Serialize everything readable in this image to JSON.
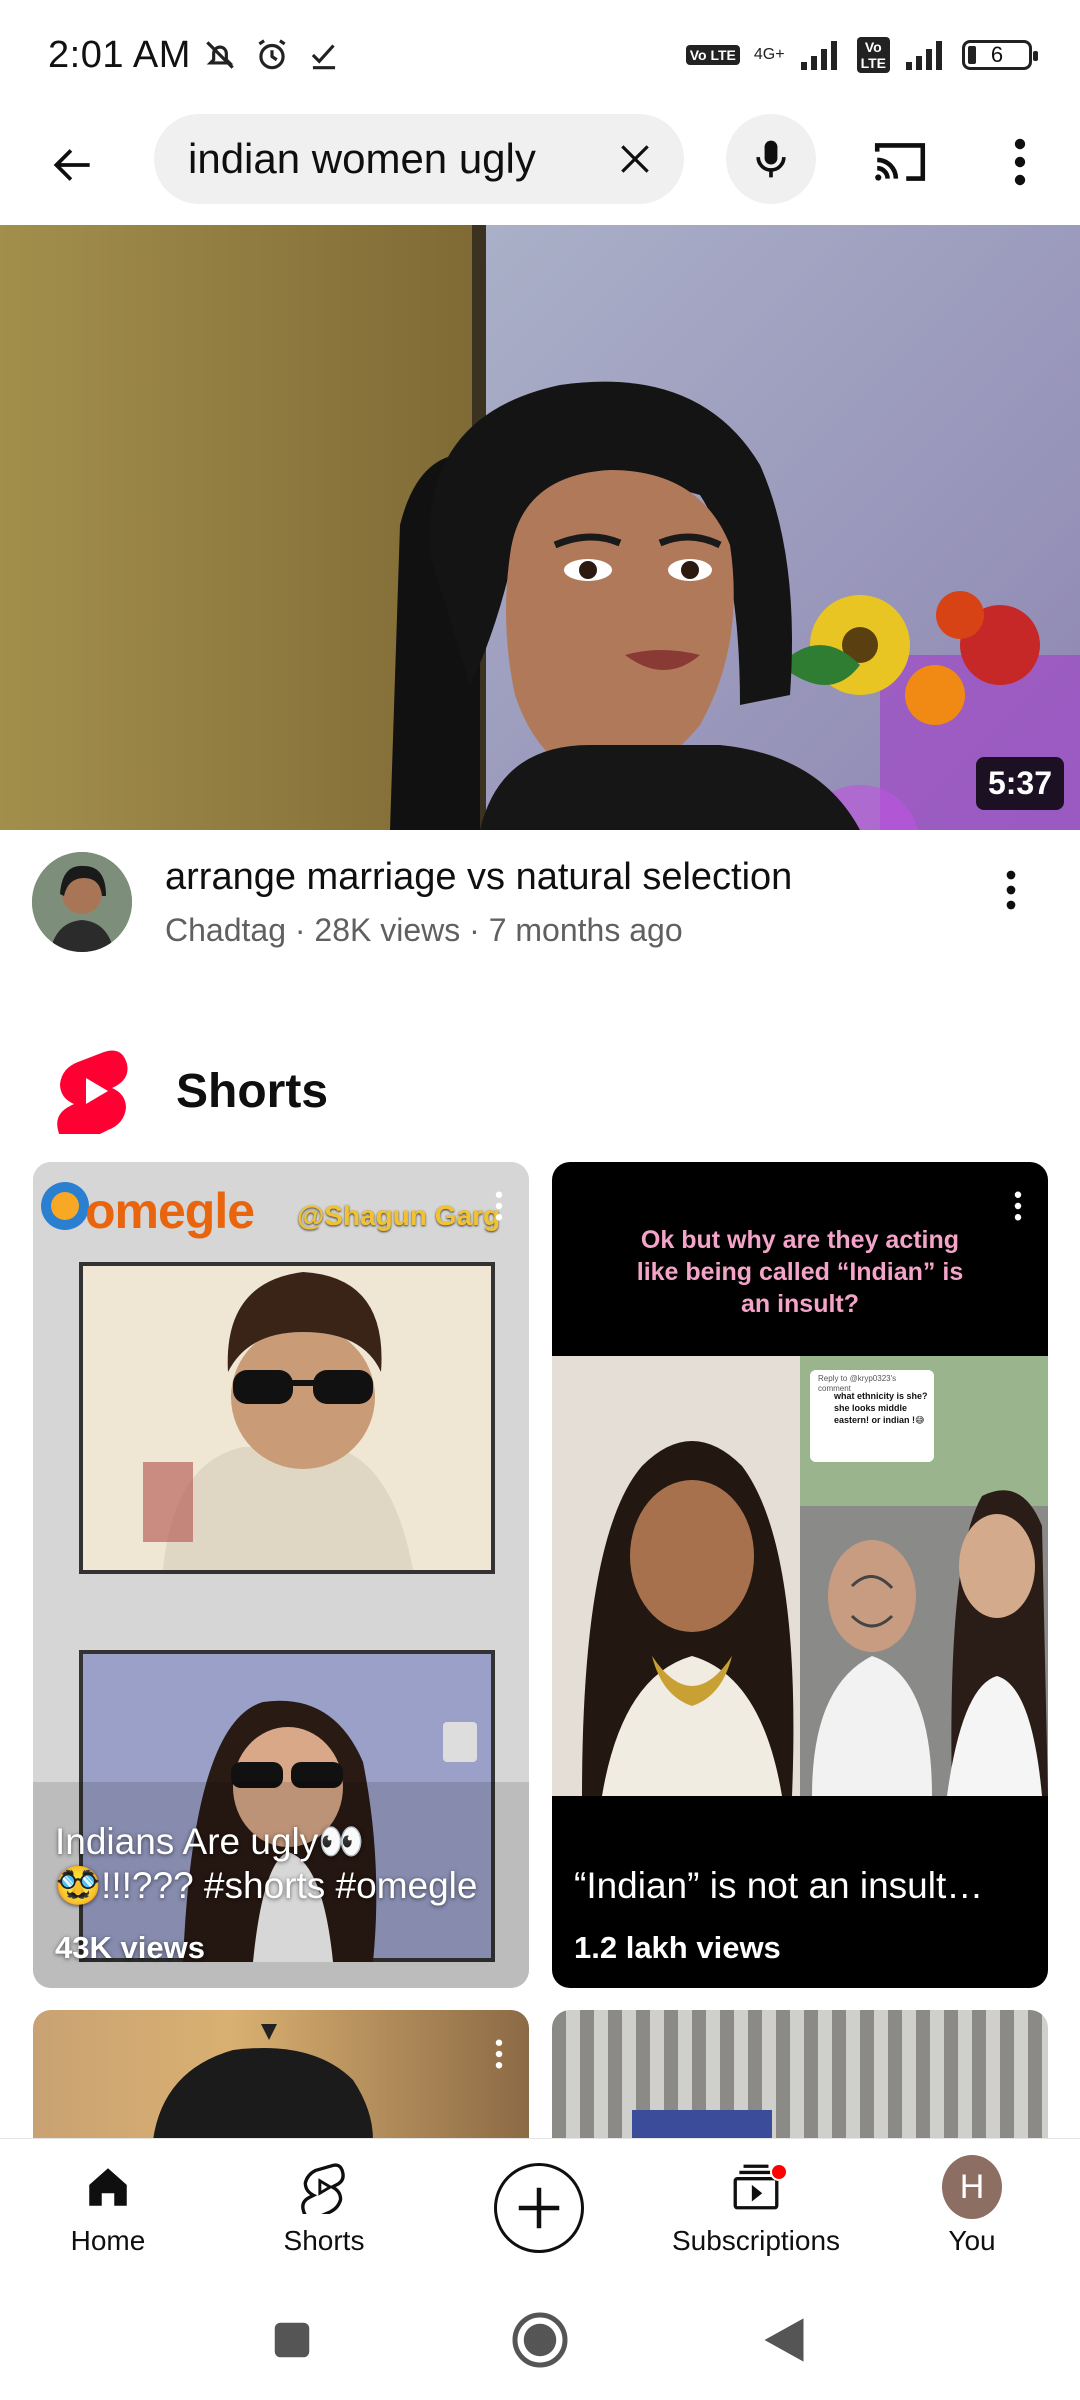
{
  "status_bar": {
    "time": "2:01 AM",
    "network_label": "4G+",
    "lte_label": "Vo LTE",
    "battery_level": "6"
  },
  "search": {
    "query": "indian women ugly"
  },
  "video": {
    "duration": "5:37",
    "title": "arrange marriage vs natural selection",
    "subtitle": "Chadtag · 28K views · 7 months ago"
  },
  "shorts_shelf": {
    "title": "Shorts",
    "items": [
      {
        "overlay_brand": "omegle",
        "overlay_handle": "@Shagun Garg",
        "title_line1": "Indians Are ugly👀",
        "title_line2": "🥸!!!??? #shorts #omegle",
        "views": "43K views"
      },
      {
        "caption": "Ok but why are they acting like being called “Indian” is an insult?",
        "comment_header": "Reply to @kryp0323's comment",
        "comment_text": "what ethnicity is she? she looks middle eastern! or indian !😅",
        "title": "“Indian” is not an insult…",
        "views": "1.2 lakh views"
      }
    ]
  },
  "bottom_nav": {
    "items": [
      {
        "label": "Home",
        "icon": "home-icon"
      },
      {
        "label": "Shorts",
        "icon": "shorts-icon"
      },
      {
        "label": "",
        "icon": "create-icon"
      },
      {
        "label": "Subscriptions",
        "icon": "subscriptions-icon"
      },
      {
        "label": "You",
        "icon": "avatar",
        "avatar_letter": "H"
      }
    ]
  },
  "colors": {
    "youtube_red": "#FF0033",
    "text_primary": "#0f0f0f",
    "text_secondary": "#606060",
    "pill_bg": "#f0f0f0",
    "notification_dot": "#ff0000",
    "avatar_bg": "#8d6e63"
  }
}
